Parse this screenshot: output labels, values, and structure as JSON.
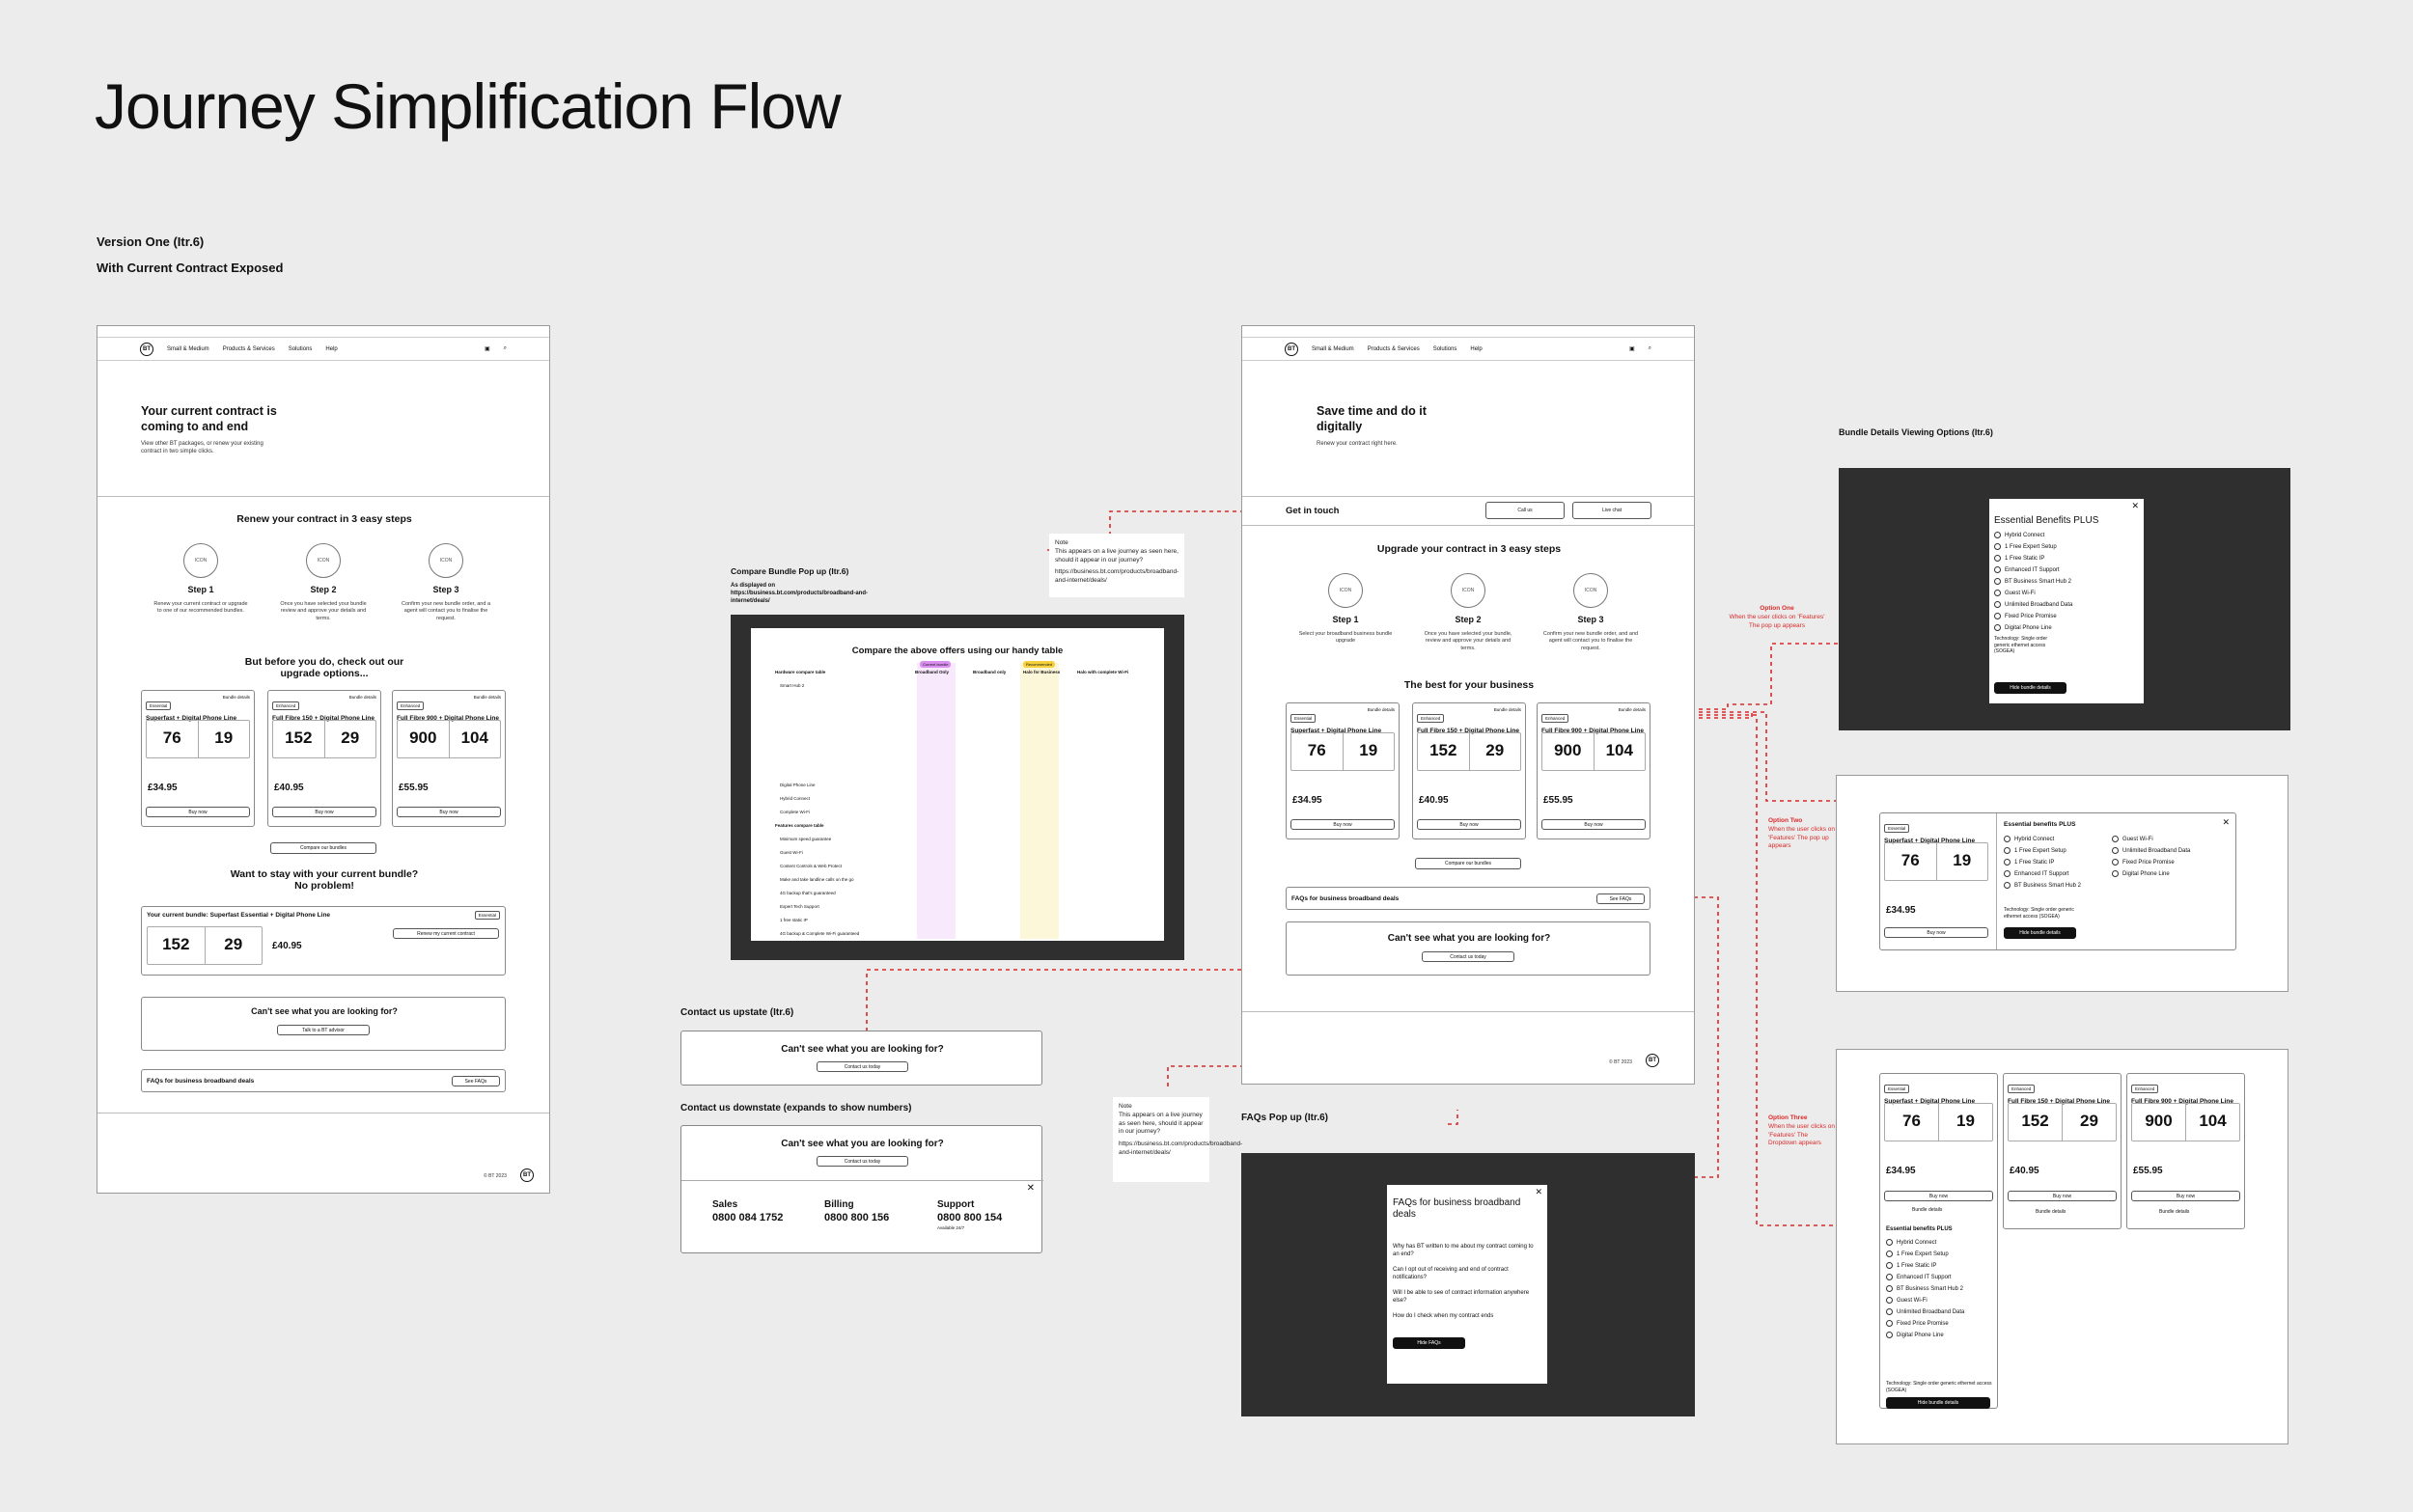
{
  "page": {
    "title": "Journey Simplification Flow",
    "version": "Version One (Itr.6)",
    "subtitle": "With Current Contract Exposed"
  },
  "nav": {
    "brand": "BT",
    "product_line": "Small & Medium",
    "menu": [
      "Products & Services",
      "Solutions",
      "Help"
    ]
  },
  "frame1": {
    "hero_title": "Your current contract is coming to and end",
    "hero_text": "View other BT packages, or renew your existing contract in two simple clicks.",
    "steps_title": "Renew your contract in 3 easy steps",
    "steps": [
      {
        "icon": "ICON",
        "title": "Step 1",
        "text": "Renew your current contract or upgrade to one of our recommended bundles."
      },
      {
        "icon": "ICON",
        "title": "Step 2",
        "text": "Once you have selected your bundle review and approve your details and terms."
      },
      {
        "icon": "ICON",
        "title": "Step 3",
        "text": "Confirm your new bundle order, and a agent will contact you to finalise the request."
      }
    ],
    "upgrade_title": "But before you do, check out our upgrade options...",
    "compare_button": "Compare our bundles",
    "stay_title": "Want to stay with your current bundle? No problem!",
    "current_bundle": {
      "label": "Your current bundle: Superfast Essential + Digital Phone Line",
      "tag": "Essential",
      "down": "152",
      "up": "29",
      "price": "£40.95",
      "button": "Renew my current contract"
    },
    "cant_see": "Can't see what you are looking for?",
    "talk_button": "Talk to a BT advisor",
    "faq_label": "FAQs for business broadband deals",
    "faq_button": "See FAQs"
  },
  "bundles": [
    {
      "tag": "Essential",
      "name": "Superfast + Digital Phone Line",
      "down": "76",
      "up": "19",
      "price": "£34.95"
    },
    {
      "tag": "Enhanced",
      "name": "Full Fibre 150 + Digital Phone Line",
      "down": "152",
      "up": "29",
      "price": "£40.95"
    },
    {
      "tag": "Enhanced",
      "name": "Full Fibre 900 + Digital Phone Line",
      "down": "900",
      "up": "104",
      "price": "£55.95"
    }
  ],
  "bundle_details": "Bundle details",
  "buy_now": "Buy now",
  "footer": {
    "copyright": "© BT 2023"
  },
  "compare_popup": {
    "label": "Compare Bundle Pop up (Itr.6)",
    "sub": "As displayed on https://business.bt.com/products/broadband-and-internet/deals/",
    "heading": "Compare the above offers using our handy table",
    "columns": [
      "Broadband Only",
      "Broadband only",
      "Halo for Business",
      "Halo with complete Wi-Fi"
    ],
    "rows": [
      "Hardware compare table",
      "Smart Hub 2",
      "Digital Phone Line",
      "Hybrid Connect",
      "Complete Wi-Fi",
      "Features compare table",
      "Minimum speed guarantee",
      "Guest Wi-Fi",
      "Content Controls & Web Protect",
      "Make and take landline calls on the go",
      "4G backup that's guaranteed",
      "Expert Tech Support",
      "1 free static IP",
      "4G backup & Complete Wi-Fi guaranteed"
    ],
    "badges": [
      "Current bundle",
      "Recommended"
    ]
  },
  "note1": {
    "title": "Note",
    "text": "This appears on a live journey as seen here, should it appear in our journey?",
    "link": "https://business.bt.com/products/broadband-and-internet/deals/"
  },
  "note2": {
    "title": "Note",
    "text": "This appears on a live journey as seen here, should it appear in our journey?",
    "link": "https://business.bt.com/products/broadband-and-internet/deals/"
  },
  "contact_up": {
    "label": "Contact us upstate (Itr.6)",
    "heading": "Can't see what you are looking for?",
    "button": "Contact us today"
  },
  "contact_down": {
    "label": "Contact us downstate (expands to show numbers)",
    "heading": "Can't see what you are looking for?",
    "button": "Contact us today",
    "lines": [
      {
        "name": "Sales",
        "number": "0800 084 1752"
      },
      {
        "name": "Billing",
        "number": "0800 800 156"
      },
      {
        "name": "Support",
        "number": "0800 800 154",
        "hours": "Available 24/7"
      }
    ]
  },
  "frame2": {
    "hero_title": "Save time and do it digitally",
    "hero_text": "Renew your contract right here.",
    "get_in_touch": "Get in touch",
    "call_button": "Call us",
    "chat_button": "Live chat",
    "steps_title": "Upgrade your contract in 3 easy steps",
    "steps": [
      {
        "icon": "ICON",
        "title": "Step 1",
        "text": "Select your broadband business bundle upgrade"
      },
      {
        "icon": "ICON",
        "title": "Step 2",
        "text": "Once you have selected your bundle, review and approve your details and terms."
      },
      {
        "icon": "ICON",
        "title": "Step 3",
        "text": "Confirm your new bundle order, and and agent will contact you to finalise the request."
      }
    ],
    "best_title": "The best for your business",
    "compare_button": "Compare our bundles",
    "faq_label": "FAQs for business broadband deals",
    "faq_button": "See FAQs",
    "cant_see": "Can't see what you are looking for?",
    "contact_button": "Contact us today"
  },
  "faq_popup": {
    "label": "FAQs Pop up (Itr.6)",
    "heading": "FAQs for business broadband deals",
    "items": [
      "Why has BT written to me about my contract coming to an end?",
      "Can I opt out of receiving and end of contract notifications?",
      "Will I be able to see of contract information anywhere else?",
      "How do I check when my contract ends"
    ],
    "button": "Hide FAQs"
  },
  "bundle_options": {
    "label": "Bundle Details Viewing Options (Itr.6)",
    "benefits_title": "Essential Benefits PLUS",
    "benefits_title_alt": "Essential benefits PLUS",
    "benefits": [
      "Hybrid Connect",
      "1 Free Expert Setup",
      "1 Free Static IP",
      "Enhanced IT Support",
      "BT Business Smart Hub 2",
      "Guest Wi-Fi",
      "Unlimited Broadband Data",
      "Fixed Price Promise",
      "Digital Phone Line"
    ],
    "technology": "Technology: Single order generic ethernet access (SOGEA)",
    "hide_button": "Hide bundle details",
    "bundle_details_link": "Bundle details",
    "option_labels": [
      {
        "title": "Option One",
        "text": "When the user clicks on 'Features' The pop up appears"
      },
      {
        "title": "Option Two",
        "text": "When the user clicks on 'Features' The pop up appears"
      },
      {
        "title": "Option Three",
        "text": "When the user clicks on 'Features' The Dropdown appears"
      }
    ]
  },
  "colors": {
    "accent_red": "#d92a2a",
    "dark_bg": "#2f2f2f",
    "canvas": "#ececec",
    "badge_purple": "#d98ef0",
    "badge_yellow": "#f7d13b"
  }
}
